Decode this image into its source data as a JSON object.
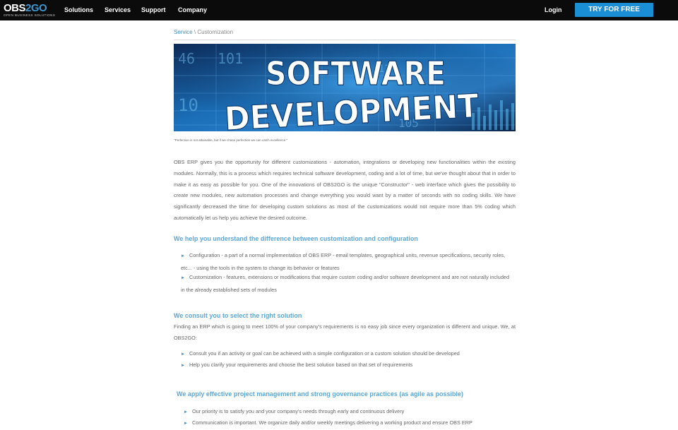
{
  "header": {
    "logo_main": "OBS",
    "logo_accent": "2GO",
    "logo_sub": "OPEN BUSINESS SOLUTIONS",
    "nav": [
      "Solutions",
      "Services",
      "Support",
      "Company"
    ],
    "login": "Login",
    "cta": "TRY FOR FREE"
  },
  "breadcrumb": {
    "link": "Service",
    "separator": " \\ ",
    "current": "Customization"
  },
  "hero": {
    "line1": "SOFTWARE",
    "line2": "DEVELOPMENT",
    "numbers": [
      "46",
      "101",
      "10",
      "105",
      "12"
    ]
  },
  "caption": "\"Perfection is not attainable, but if we chase perfection we can catch excellence.\"",
  "intro": "OBS ERP gives you the opportunity for different customizations - automation, integrations or developing new functionalities within the existing modules. Normally, this is a process which requires technical software development, coding and a lot of time, but we've thought about that in order to make it as easy as possible for you. One of the innovations of OBS2GO is the unique \"Constructor\" - web interface which gives the possibility to create new modules, new automation processes and change everything you would want by a matter of seconds with no coding skills. We have significantly decreased the time for developing custom solutions as most of the customizations would not require more than 5% coding which automatically let us help you achieve the desired outcome.",
  "section1": {
    "heading": "We help you understand the difference between customization and configuration",
    "bullets": [
      "Configuration - a part of a normal implementation of OBS ERP - email templates, geographical units, revenue specifications, security roles, etc... - using the tools in the system to change its behavior or features",
      "Customization - features, extensions or modifications that require custom coding and/or software development and are not naturally included in the already established sets of modules"
    ]
  },
  "section2": {
    "heading": "We consult you to select the right solution",
    "text": "Finding an ERP which is going to meet 100% of your company's requirements is no easy job since every organization is different and unique. We, at OBS2GO:",
    "bullets": [
      "Consult you if an activity or goal can be achieved with a simple configuration or a custom solution should be developed",
      "Help you clarify your requirements and choose the best solution based on that set of requirements"
    ]
  },
  "section3": {
    "heading": "We apply effective project management and strong governance practices (as agile as possible)",
    "bullets": [
      "Our priority is to satisfy you and your company's needs through early and continuous delivery",
      "Communication is important. We organize daily and/or weekly meetings delivering a working product and ensure OBS ERP"
    ]
  },
  "colors": {
    "accent": "#1a8fd6",
    "heading": "#5aa7da",
    "topbar": "#0b0b0b"
  }
}
